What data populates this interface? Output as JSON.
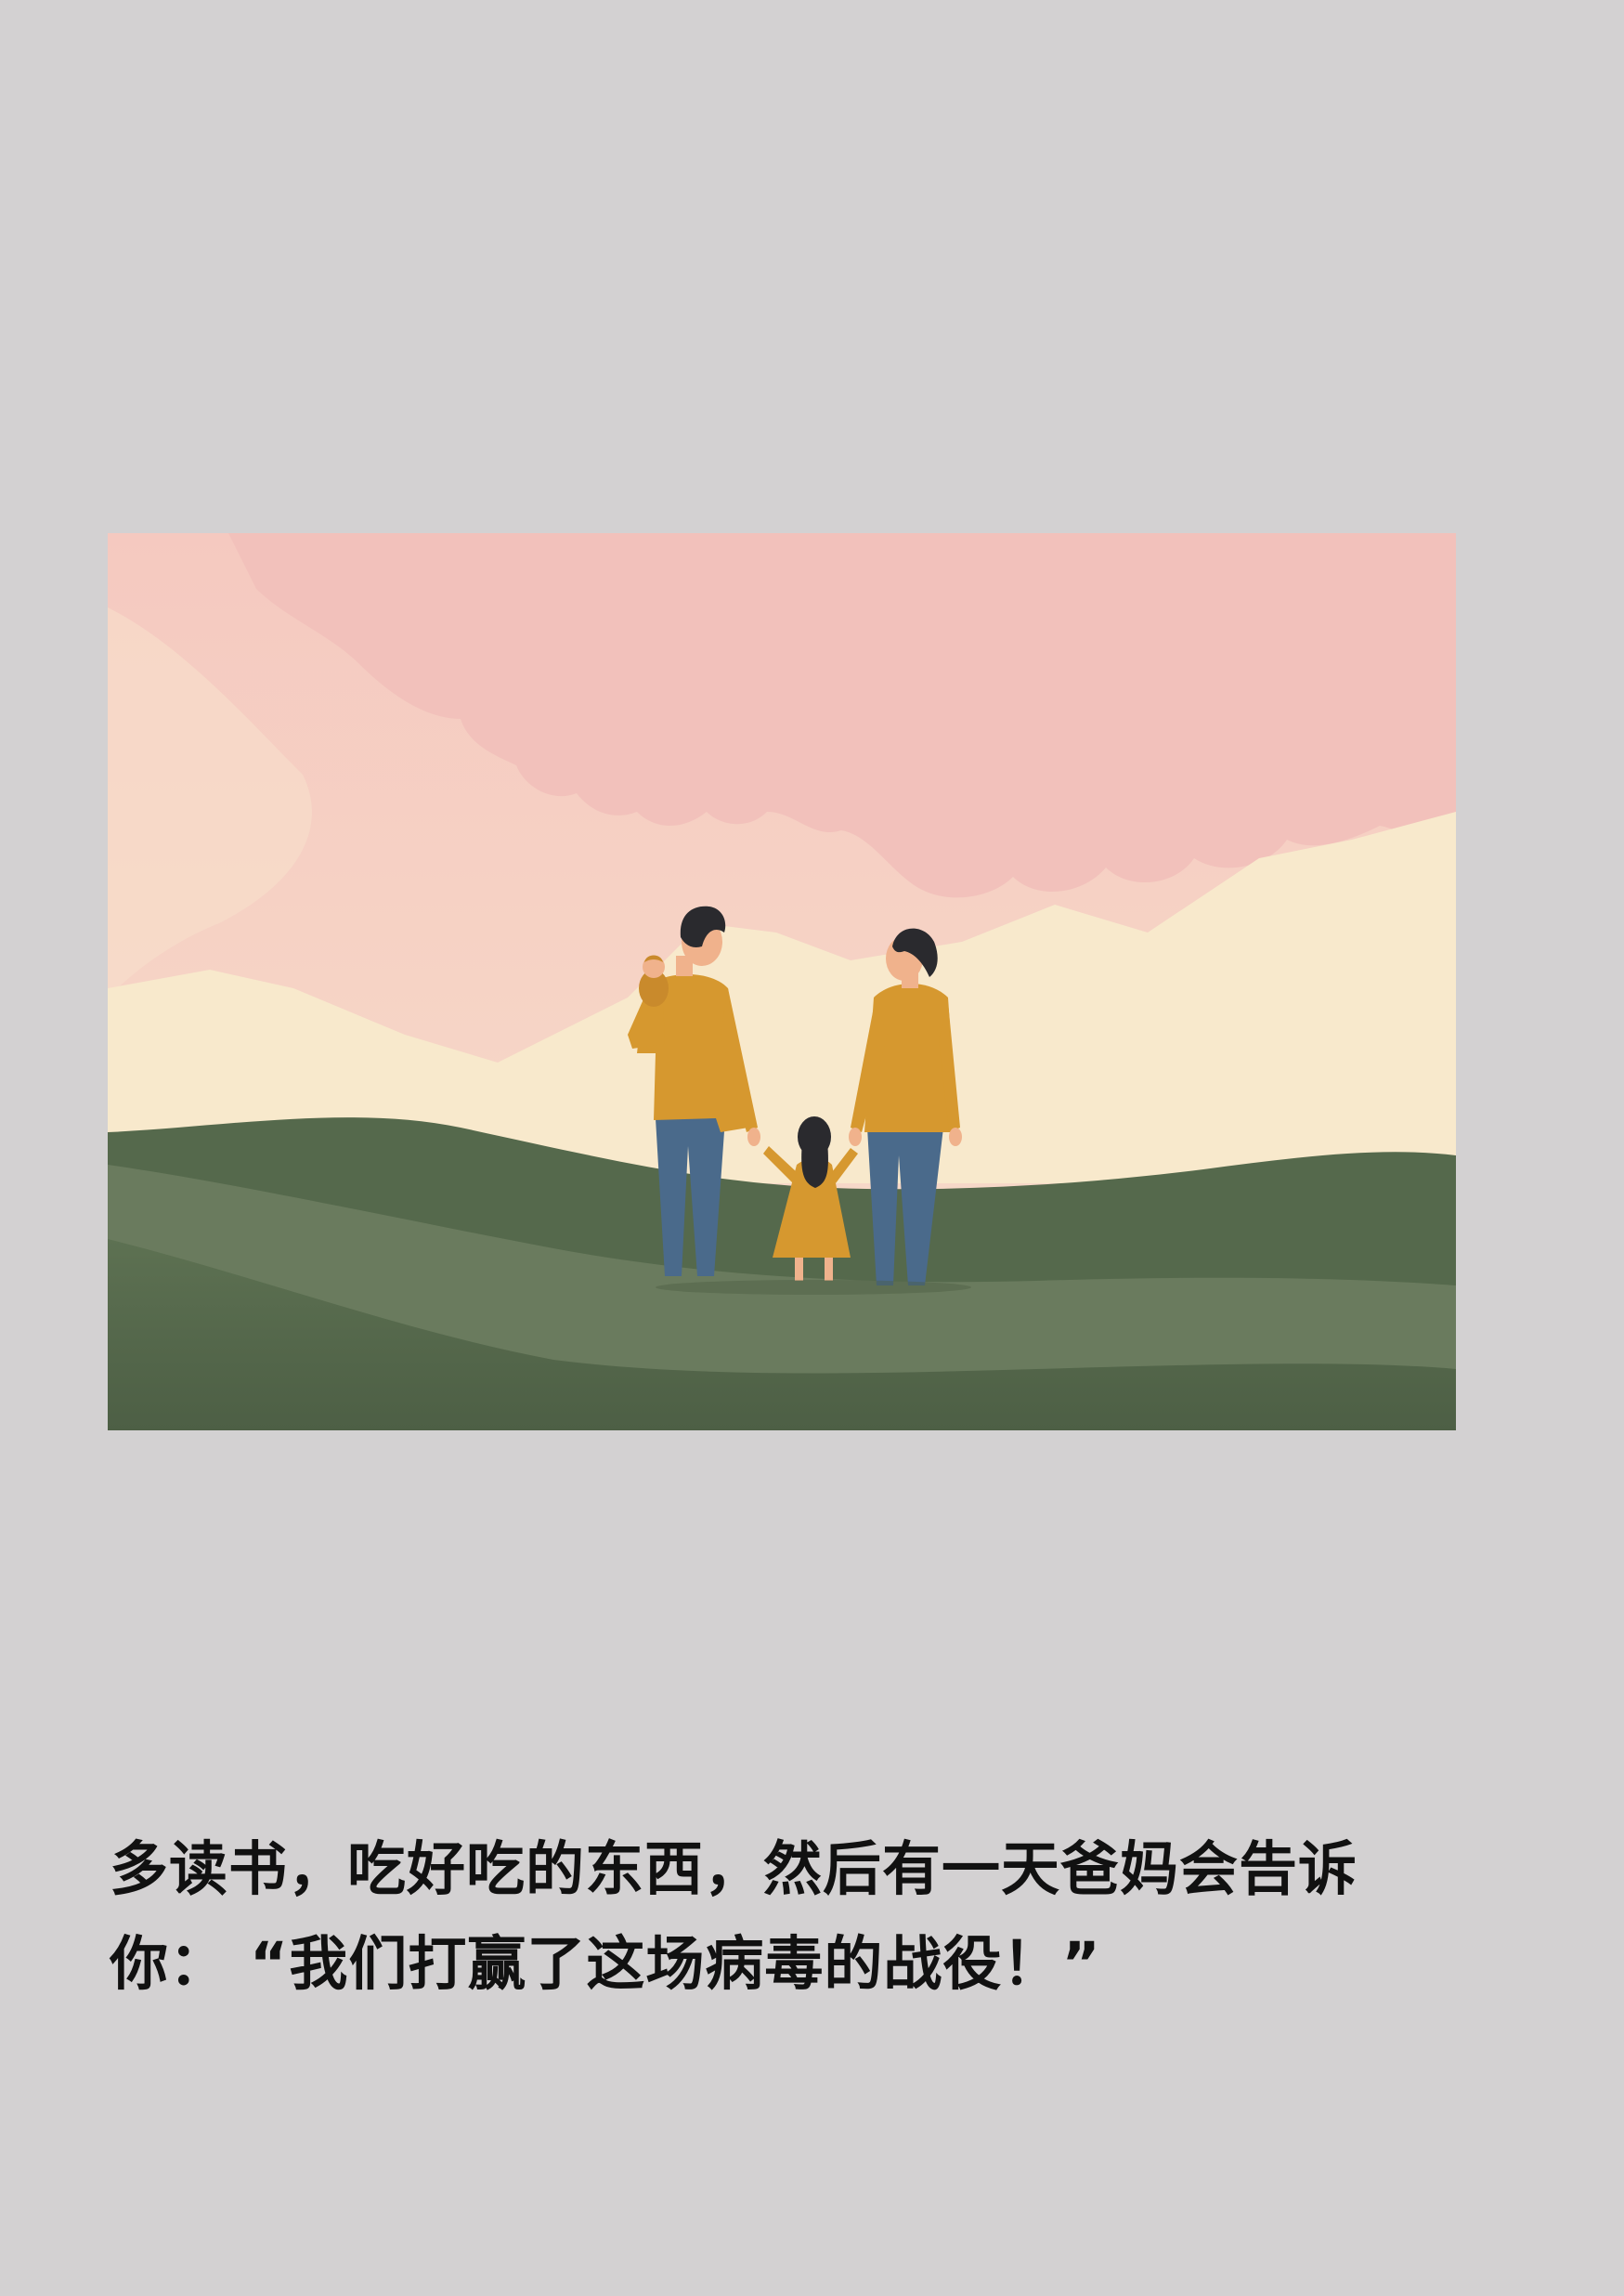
{
  "page": {
    "background_color": "#d3d1d2"
  },
  "illustration": {
    "subject": "family-of-four-on-green-hills",
    "colors": {
      "sky_pink": "#f3c6bf",
      "cloud_pink": "#f2c1bb",
      "mountain_cream": "#f8e9cc",
      "hill_dark_green": "#55694c",
      "hill_light_green": "#6a7b5e",
      "sweater_mustard": "#d6982f",
      "jeans_blue": "#4a6a8b",
      "hair_dark": "#2a2a2e",
      "skin": "#f0b28c"
    }
  },
  "caption": {
    "line1": "多读书，吃好吃的东西，然后有一天爸妈会告诉",
    "line2": "你：  “我们打赢了这场病毒的战役！”"
  }
}
